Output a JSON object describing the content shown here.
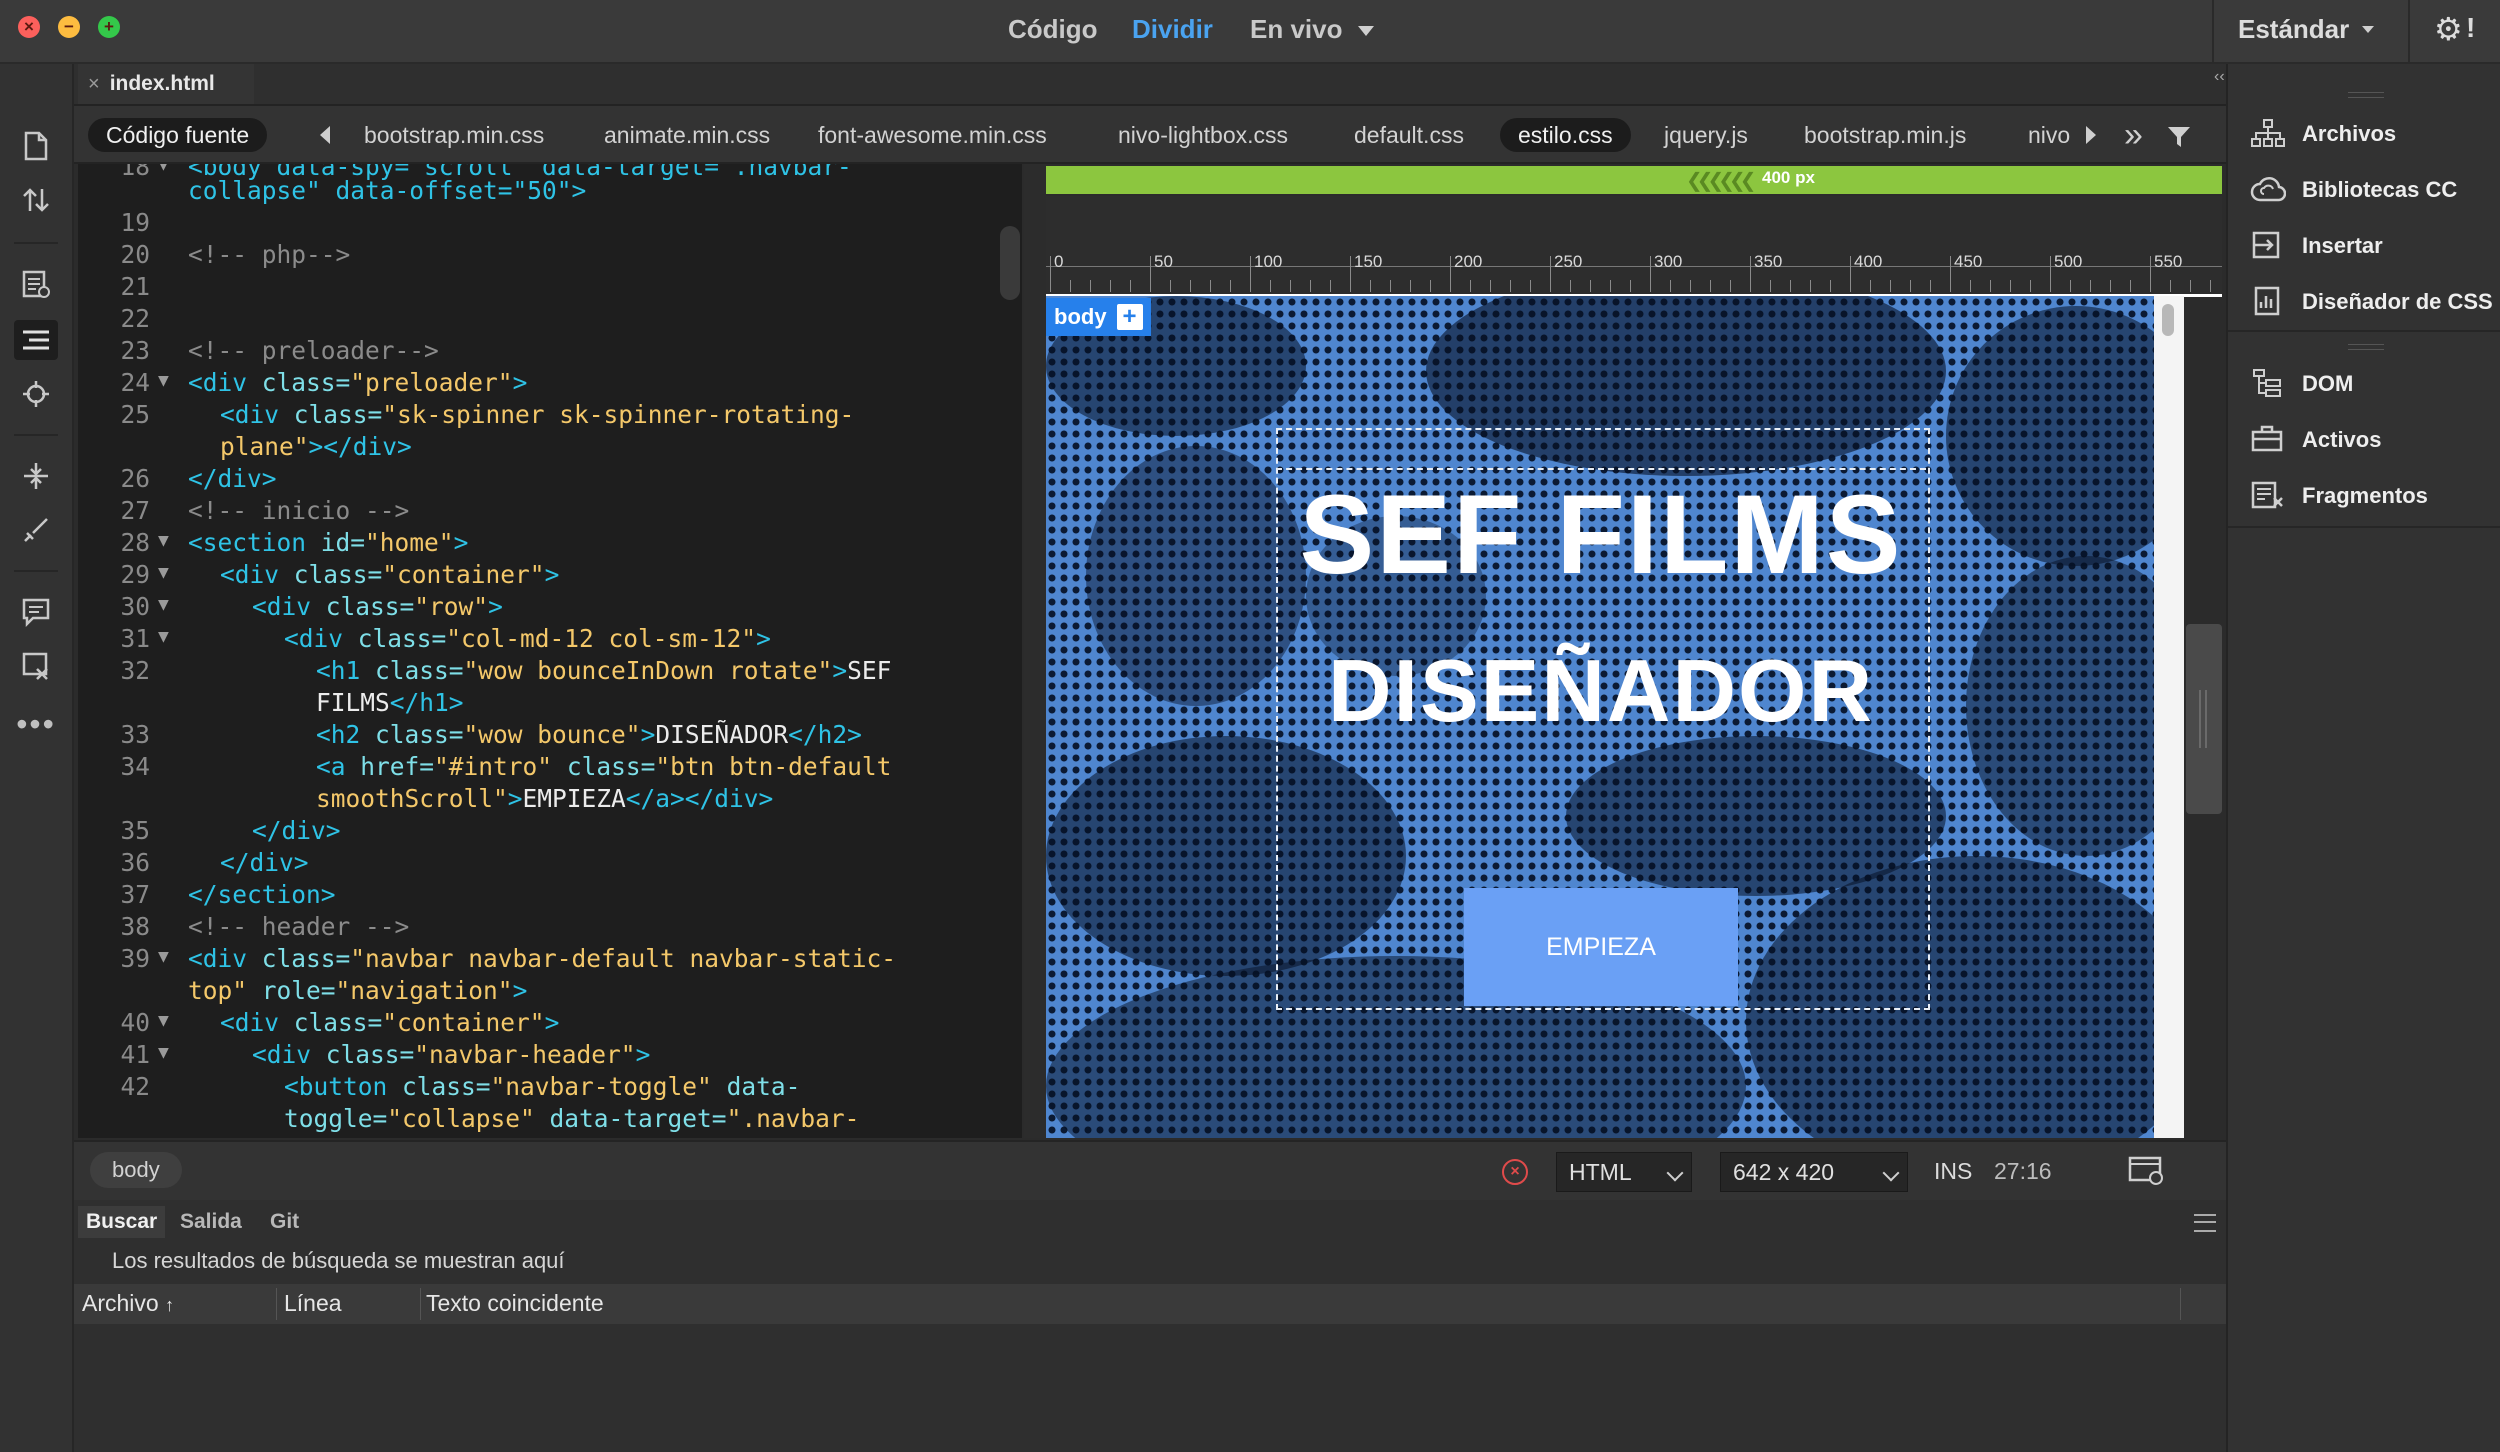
{
  "titlebar": {
    "modes": {
      "code": "Código",
      "split": "Dividir",
      "live": "En vivo"
    },
    "workspace": "Estándar",
    "settings_icon": "gear-icon",
    "settings_badge": "!"
  },
  "document": {
    "tab_close": "×",
    "tab_name": "index.html"
  },
  "related_files": {
    "source": "Código fuente",
    "files": [
      "bootstrap.min.css",
      "animate.min.css",
      "font-awesome.min.css",
      "nivo-lightbox.css",
      "default.css",
      "estilo.css",
      "jquery.js",
      "bootstrap.min.js",
      "nivo"
    ],
    "active": "estilo.css"
  },
  "code": {
    "top_partial_1": "<body data-spy=\"scroll\" data-target=\".navbar-",
    "top_partial_2": "collapse\" data-offset=\"50\">",
    "line_numbers": [
      "18",
      "19",
      "20",
      "21",
      "22",
      "23",
      "24",
      "25",
      "26",
      "27",
      "28",
      "29",
      "30",
      "31",
      "32",
      "33",
      "34",
      "35",
      "36",
      "37",
      "38",
      "39",
      "40",
      "41",
      "42"
    ]
  },
  "live_view": {
    "width_label": "400 px",
    "ruler_marks": [
      "0",
      "50",
      "100",
      "150",
      "200",
      "250",
      "300",
      "350",
      "400",
      "450",
      "500",
      "550"
    ],
    "element_badge": "body",
    "badge_plus": "+",
    "hero_title": "SEF FILMS",
    "hero_subtitle": "DISEÑADOR",
    "cta_button": "EMPIEZA"
  },
  "status_bar": {
    "tag_selector": "body",
    "doc_type": "HTML",
    "window_size": "642 x 420",
    "insert_mode": "INS",
    "cursor_position": "27:16"
  },
  "bottom_panel": {
    "tabs": [
      "Buscar",
      "Salida",
      "Git"
    ],
    "active_tab": "Buscar",
    "results_message": "Los resultados de búsqueda se muestran aquí",
    "columns": [
      "Archivo",
      "Línea",
      "Texto coincidente"
    ]
  },
  "right_panel": {
    "group1": [
      "Archivos",
      "Bibliotecas CC",
      "Insertar",
      "Diseñador de CSS"
    ],
    "group2": [
      "DOM",
      "Activos",
      "Fragmentos"
    ]
  },
  "colors": {
    "accent_blue": "#4aa3f0",
    "live_green": "#8cc63f",
    "hero_bg": "#4f86cf",
    "cta_bg": "#6aa0f5"
  }
}
